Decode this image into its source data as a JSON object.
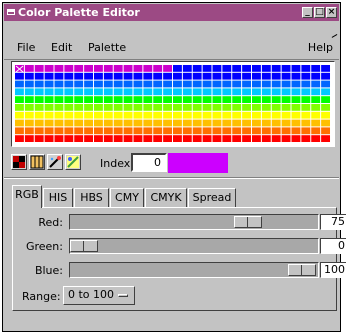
{
  "window": {
    "title": "Color Palette Editor"
  },
  "titlebar_buttons": [
    "_",
    "□",
    "×"
  ],
  "menu": {
    "file": "File",
    "edit": "Edit",
    "palette": "Palette",
    "help": "Help"
  },
  "palette": {
    "rows": [
      "#0000ff",
      "#0066ff",
      "#00c8ff",
      "#00ff00",
      "#80ff00",
      "#ffff00",
      "#ffc000",
      "#ff7000",
      "#ff0000"
    ],
    "first_row": [
      "#cc00cc",
      "#0000ff"
    ],
    "columns": 32
  },
  "tools": [
    {
      "name": "split-colors-icon",
      "color": "#c00000"
    },
    {
      "name": "grid-icon",
      "color": "#d08000"
    },
    {
      "name": "magic-wand-icon",
      "color": "#c04040"
    },
    {
      "name": "gradient-icon",
      "color": "#40a040"
    }
  ],
  "index": {
    "label": "Index:",
    "value": "0",
    "swatch": "#cc00ff"
  },
  "tabs": [
    "RGB",
    "HIS",
    "HBS",
    "CMY",
    "CMYK",
    "Spread"
  ],
  "active_tab": "RGB",
  "sliders": [
    {
      "label": "Red:",
      "value": "75",
      "fraction": 0.75
    },
    {
      "label": "Green:",
      "value": "0",
      "fraction": 0.0
    },
    {
      "label": "Blue:",
      "value": "100",
      "fraction": 1.0
    }
  ],
  "range": {
    "label": "Range:",
    "value": "0 to 100"
  }
}
